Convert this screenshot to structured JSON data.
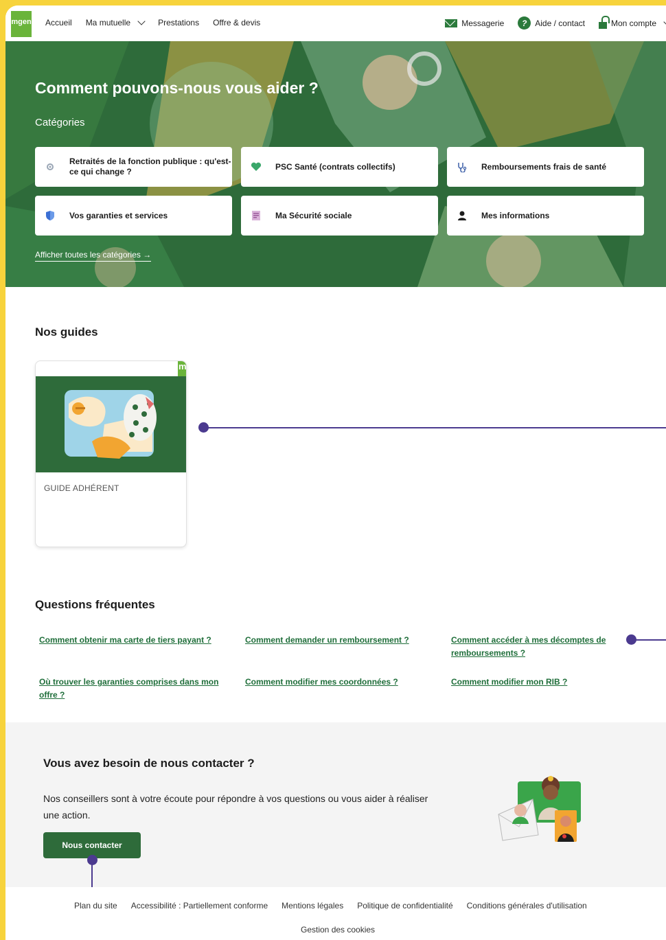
{
  "nav": {
    "logo_text": "mgen",
    "links": [
      "Accueil",
      "Ma mutuelle",
      "Prestations",
      "Offre & devis"
    ],
    "messagerie": "Messagerie",
    "aide_contact": "Aide / contact",
    "mon_compte": "Mon compte"
  },
  "hero": {
    "title": "Comment pouvons-nous vous aider ?",
    "categories_label": "Catégories",
    "cards": [
      {
        "label": "Retraités de la fonction publique : qu'est-ce qui change ?",
        "icon": "gear-icon"
      },
      {
        "label": "PSC Santé (contrats collectifs)",
        "icon": "heart-icon"
      },
      {
        "label": "Remboursements frais de santé",
        "icon": "stethoscope-icon"
      },
      {
        "label": "Vos garanties et services",
        "icon": "shield-icon"
      },
      {
        "label": "Ma Sécurité sociale",
        "icon": "document-icon"
      },
      {
        "label": "Mes informations",
        "icon": "user-icon"
      }
    ],
    "all_categories": "Afficher toutes les catégories →"
  },
  "guides": {
    "title": "Nos guides",
    "card_label": "GUIDE ADHÉRENT",
    "card_logo_letter": "m"
  },
  "faq": {
    "title": "Questions fréquentes",
    "items": [
      "Comment obtenir ma carte de tiers payant ?",
      "Comment demander un remboursement ?",
      "Comment accéder à mes décomptes de remboursements ?",
      "Où trouver les garanties comprises dans mon offre ?",
      "Comment modifier mes coordonnées ?",
      "Comment modifier mon RIB ?"
    ]
  },
  "contact": {
    "title": "Vous avez besoin de nous contacter ?",
    "text": "Nos conseillers sont à votre écoute pour répondre à vos questions ou vous aider à réaliser une action.",
    "button": "Nous contacter"
  },
  "footer": {
    "links": [
      "Plan du site",
      "Accessibilité : Partiellement conforme",
      "Mentions légales",
      "Politique de confidentialité",
      "Conditions générales d'utilisation"
    ],
    "cookies": "Gestion des cookies"
  },
  "colors": {
    "page_border": "#f7d33c",
    "brand_green": "#2e6b3a",
    "link_green": "#1f6e3a",
    "annotation_purple": "#4b3a8f"
  }
}
